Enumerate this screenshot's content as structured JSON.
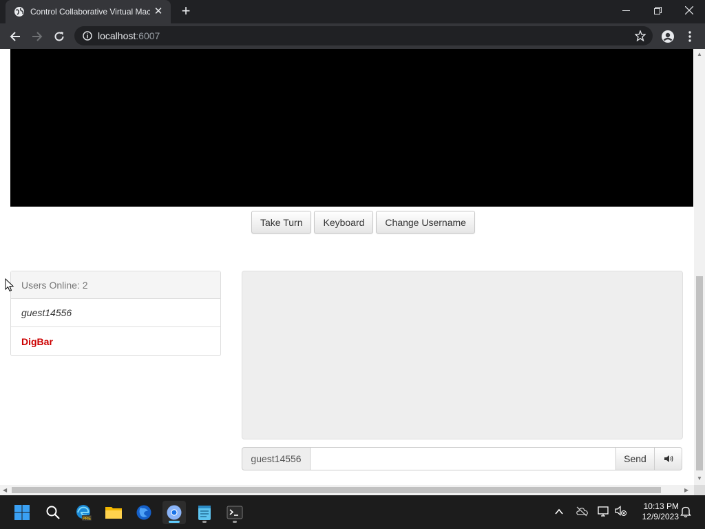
{
  "browser": {
    "tab_title": "Control Collaborative Virtual Mac",
    "url_host": "localhost",
    "url_port": ":6007"
  },
  "controls": {
    "take_turn": "Take Turn",
    "keyboard": "Keyboard",
    "change_username": "Change Username"
  },
  "users": {
    "header": "Users Online: 2",
    "list": [
      "guest14556",
      "DigBar"
    ]
  },
  "chat": {
    "username": "guest14556",
    "input_value": "",
    "send_label": "Send"
  },
  "taskbar": {
    "time": "10:13 PM",
    "date": "12/9/2023",
    "apps": [
      "start-icon",
      "search-icon",
      "edge-preview-icon",
      "file-explorer-icon",
      "firefox-icon",
      "chrome-icon",
      "notepad-icon",
      "terminal-icon"
    ]
  },
  "colors": {
    "turn_user": "#cc0000",
    "chrome_dark": "#202124",
    "chat_bg": "#eeeeee"
  }
}
